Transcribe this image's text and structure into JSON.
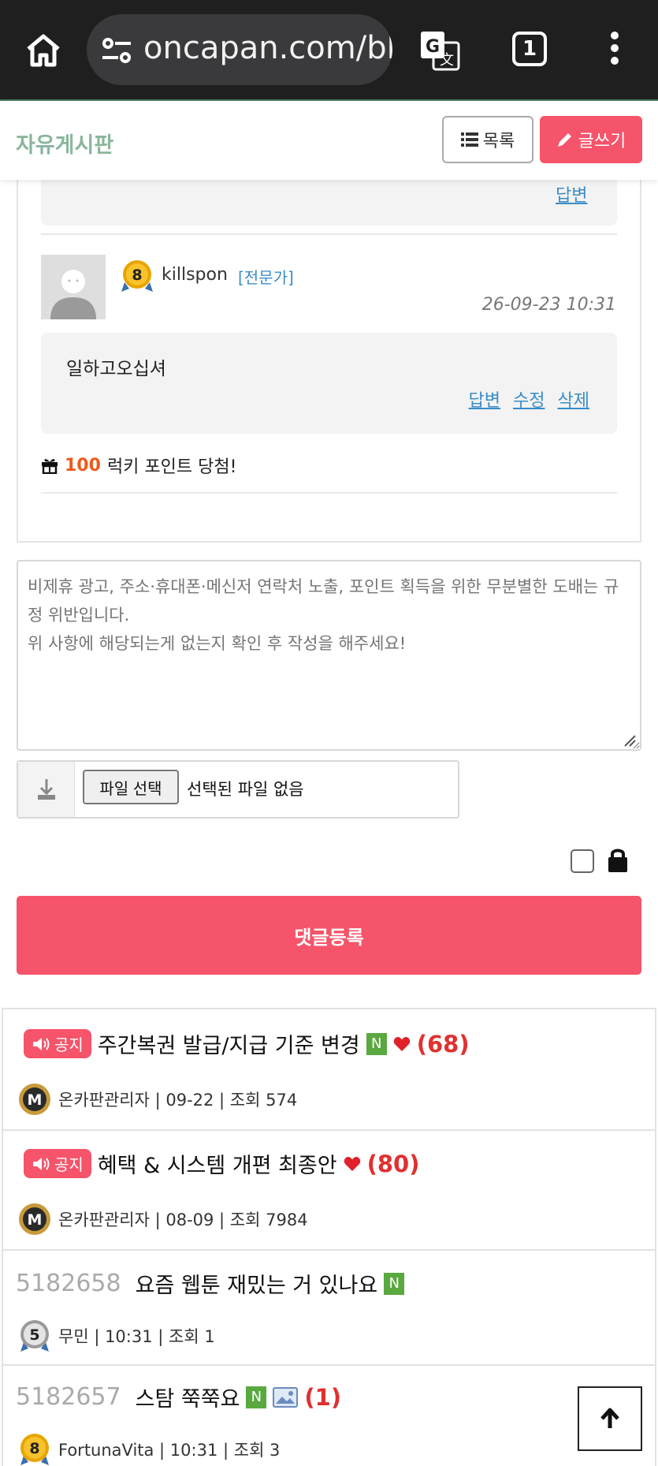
{
  "browser": {
    "url": "oncapan.com/bl",
    "tab_count": "1"
  },
  "board": {
    "title": "자유게시판",
    "list_label": "목록",
    "write_label": "글쓰기"
  },
  "previous_comment": {
    "reply_label": "답변"
  },
  "comment": {
    "level": "8",
    "username": "killspon",
    "tag": "[전문가]",
    "date": "26-09-23 10:31",
    "text": "일하고오십셔",
    "actions": {
      "reply": "답변",
      "edit": "수정",
      "delete": "삭제"
    },
    "lucky_points": "100",
    "lucky_text": "럭키 포인트 당첨!"
  },
  "comment_form": {
    "placeholder": "비제휴 광고, 주소·휴대폰·메신저 연락처 노출, 포인트 획득을 위한 무분별한 도배는 규정 위반입니다.\n위 사항에 해당되는게 없는지 확인 후 작성을 해주세요!",
    "file_button": "파일 선택",
    "file_status": "선택된 파일 없음",
    "submit_label": "댓글등록"
  },
  "posts": [
    {
      "notice": "공지",
      "title": "주간복권 발급/지급 기준 변경",
      "new": "N",
      "comments": "(68)",
      "meta": "온카판관리자 | 09-22 | 조회 574",
      "badge": "M"
    },
    {
      "notice": "공지",
      "title": "혜택 & 시스템 개편 최종안",
      "comments": "(80)",
      "meta": "온카판관리자 | 08-09 | 조회 7984",
      "badge": "M"
    },
    {
      "num": "5182658",
      "title": "요즘 웹툰 재밌는 거 있나요",
      "new": "N",
      "meta": "무민 | 10:31 | 조회 1",
      "badge": "5"
    },
    {
      "num": "5182657",
      "title": "스탐 쭉쭉요",
      "new": "N",
      "comments": "(1)",
      "meta": "FortunaVita | 10:31 | 조회 3",
      "badge": "8"
    }
  ],
  "colors": {
    "accent": "#f5546a",
    "board_title": "#8ab69b",
    "link": "#3a8dc8",
    "new_badge": "#5aa840",
    "comment_count": "#e03030",
    "points": "#ee5a1a"
  },
  "icons": [
    "home-icon",
    "tune-icon",
    "translate-icon",
    "kebab-menu-icon",
    "list-icon",
    "pencil-icon",
    "gift-icon",
    "download-icon",
    "lock-icon",
    "speaker-icon",
    "heart-icon",
    "image-icon",
    "arrow-up-icon"
  ]
}
